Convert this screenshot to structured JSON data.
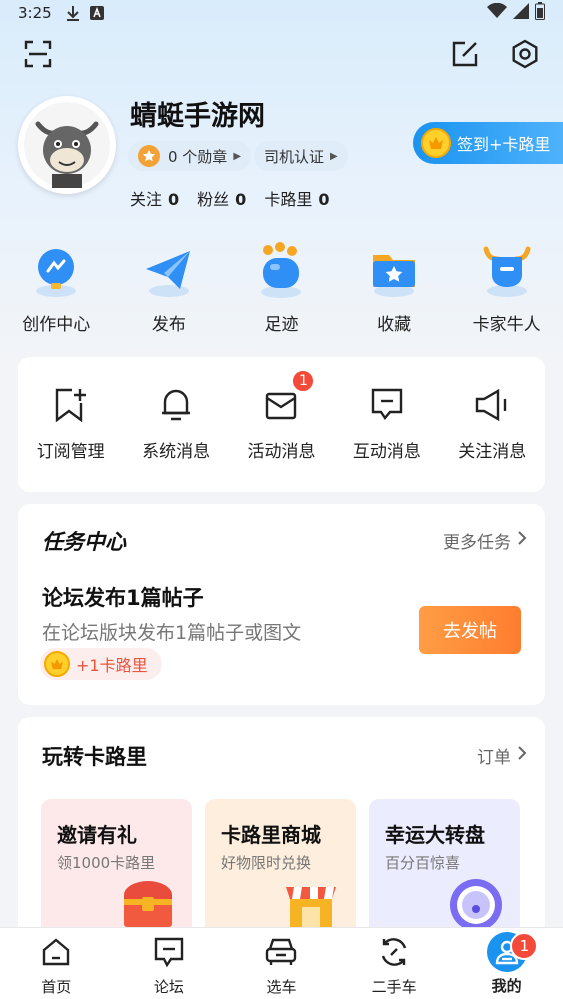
{
  "status_bar": {
    "time": "3:25"
  },
  "profile": {
    "username": "蜻蜓手游网",
    "badges": "0 个勋章",
    "driver_cert": "司机认证",
    "stats": [
      {
        "label": "关注",
        "value": "0"
      },
      {
        "label": "粉丝",
        "value": "0"
      },
      {
        "label": "卡路里",
        "value": "0"
      }
    ],
    "signin_label": "签到+卡路里"
  },
  "quick_actions": [
    {
      "label": "创作中心",
      "icon": "creator-center-icon"
    },
    {
      "label": "发布",
      "icon": "paper-plane-icon"
    },
    {
      "label": "足迹",
      "icon": "footprint-icon"
    },
    {
      "label": "收藏",
      "icon": "folder-star-icon"
    },
    {
      "label": "卡家牛人",
      "icon": "bull-icon"
    }
  ],
  "messages": [
    {
      "label": "订阅管理",
      "icon": "bookmark-add-icon",
      "badge": ""
    },
    {
      "label": "系统消息",
      "icon": "bell-icon",
      "badge": ""
    },
    {
      "label": "活动消息",
      "icon": "envelope-icon",
      "badge": "1"
    },
    {
      "label": "互动消息",
      "icon": "chat-bubble-icon",
      "badge": ""
    },
    {
      "label": "关注消息",
      "icon": "speaker-icon",
      "badge": ""
    }
  ],
  "task_center": {
    "title": "任务中心",
    "more": "更多任务",
    "task_title": "论坛发布1篇帖子",
    "task_desc": "在论坛版块发布1篇帖子或图文",
    "reward": "+1卡路里",
    "button": "去发帖"
  },
  "calorie_section": {
    "title": "玩转卡路里",
    "more": "订单",
    "cards": [
      {
        "title": "邀请有礼",
        "subtitle": "领1000卡路里",
        "bg": "#fde9e9"
      },
      {
        "title": "卡路里商城",
        "subtitle": "好物限时兑换",
        "bg": "#fdeede"
      },
      {
        "title": "幸运大转盘",
        "subtitle": "百分百惊喜",
        "bg": "#ebecfd"
      }
    ]
  },
  "tabbar": [
    {
      "label": "首页",
      "icon": "home-icon",
      "active": false
    },
    {
      "label": "论坛",
      "icon": "forum-icon",
      "active": false
    },
    {
      "label": "选车",
      "icon": "car-icon",
      "active": false
    },
    {
      "label": "二手车",
      "icon": "used-car-icon",
      "active": false
    },
    {
      "label": "我的",
      "icon": "profile-icon",
      "active": true,
      "badge": "1"
    }
  ],
  "colors": {
    "accent": "#1a93f0",
    "orange": "#ff8a35",
    "badge_red": "#f34a3a"
  }
}
